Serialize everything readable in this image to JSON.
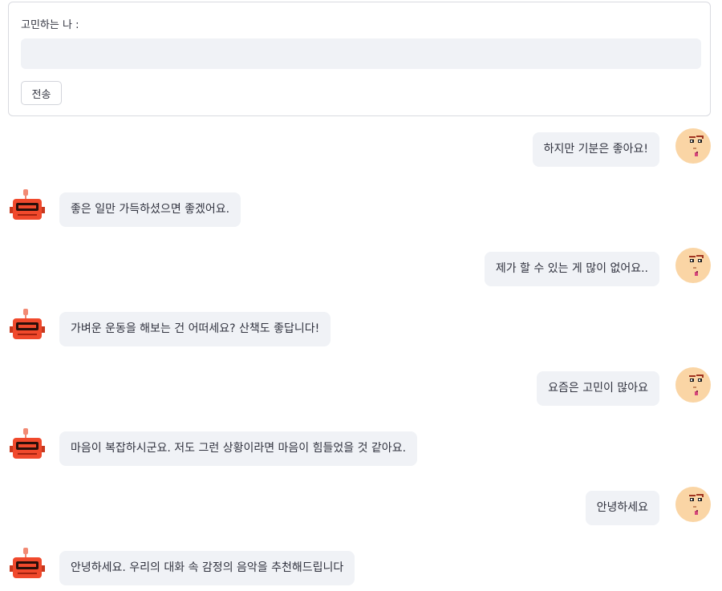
{
  "form": {
    "label": "고민하는 나 :",
    "input_value": "",
    "input_placeholder": "",
    "submit_label": "전송"
  },
  "messages": [
    {
      "sender": "user",
      "text": "하지만 기분은 좋아요!"
    },
    {
      "sender": "bot",
      "text": "좋은 일만 가득하셨으면 좋겠어요."
    },
    {
      "sender": "user",
      "text": "제가 할 수 있는 게 많이 없어요.."
    },
    {
      "sender": "bot",
      "text": "가벼운 운동을 해보는 건 어떠세요? 산책도 좋답니다!"
    },
    {
      "sender": "user",
      "text": "요즘은 고민이 많아요"
    },
    {
      "sender": "bot",
      "text": "마음이 복잡하시군요. 저도 그런 상황이라면 마음이 힘들었을 것 같아요."
    },
    {
      "sender": "user",
      "text": "안녕하세요"
    },
    {
      "sender": "bot",
      "text": "안녕하세요. 우리의 대화 속 감정의 음악을 추천해드립니다"
    }
  ],
  "icons": {
    "user_avatar": "pixel-face-avatar-icon",
    "bot_avatar": "pixel-robot-avatar-icon"
  },
  "colors": {
    "bubble_bg": "#f0f2f6",
    "user_avatar_skin": "#fad5a5",
    "bot_avatar": "#f0492c"
  }
}
